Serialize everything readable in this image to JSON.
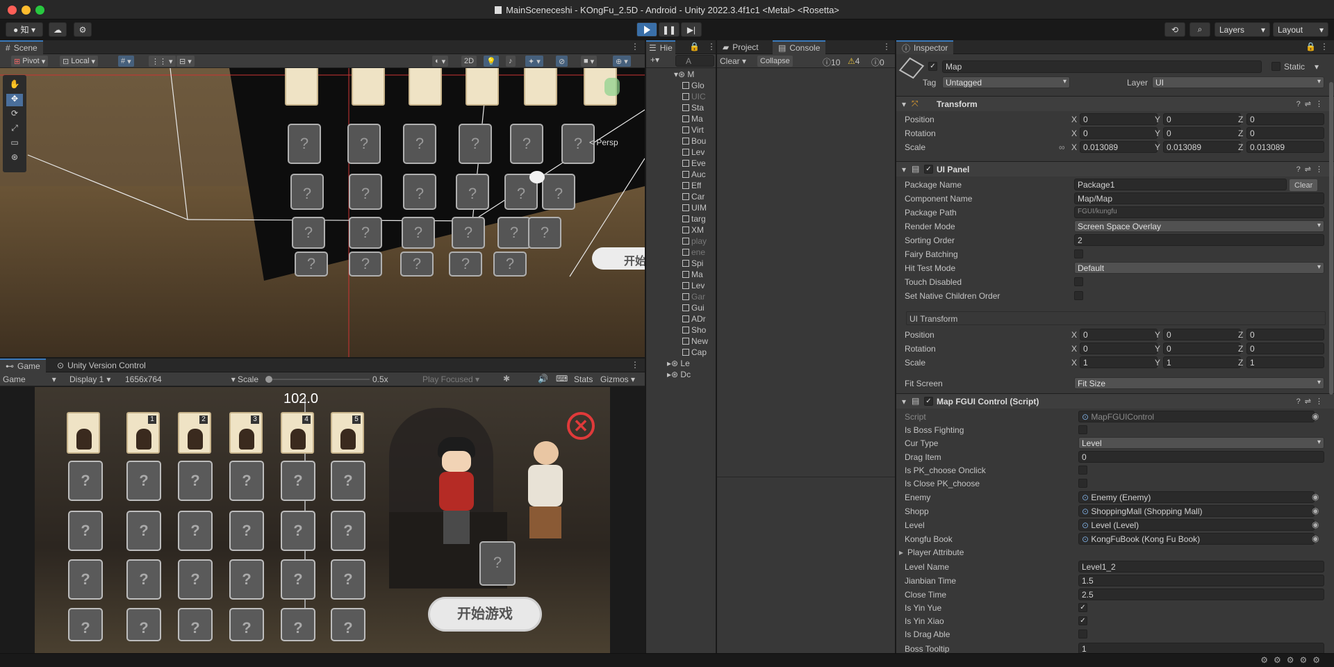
{
  "window": {
    "title": "MainSceneceshi - KOngFu_2.5D - Android - Unity 2022.3.4f1c1 <Metal> <Rosetta>"
  },
  "toolbar": {
    "account_label": "知",
    "layers_label": "Layers",
    "layout_label": "Layout"
  },
  "scene": {
    "tab_label": "Scene",
    "pivot_label": "Pivot",
    "local_label": "Local",
    "mode_2d_label": "2D",
    "persp_label": "< Persp",
    "start_label": "开始"
  },
  "game": {
    "tab_label": "Game",
    "vc_tab_label": "Unity Version Control",
    "game_dd": "Game",
    "display_dd": "Display 1",
    "resolution_dd": "1656x764",
    "scale_label": "Scale",
    "scale_value": "0.5x",
    "play_focused": "Play Focused",
    "stats_label": "Stats",
    "gizmos_label": "Gizmos",
    "counter": "102.0",
    "start_button": "开始游戏",
    "card_numbers": [
      "1",
      "2",
      "3",
      "4",
      "5"
    ]
  },
  "hierarchy": {
    "tab_label": "Hie",
    "search_placeholder": "A",
    "root_label": "M",
    "items": [
      "Glo",
      "UIC",
      "Sta",
      "Ma",
      "Virt",
      "Bou",
      "Lev",
      "Eve",
      "Auc",
      "Eff",
      "Car",
      "UIM",
      "targ",
      "XM",
      "play",
      "ene",
      "Spi",
      "Ma",
      "Lev",
      "Gar",
      "Gui",
      "ADr",
      "Sho",
      "New",
      "Cap"
    ],
    "bottom_items": [
      "Le",
      "Dc"
    ]
  },
  "project": {
    "tab_label": "Project",
    "console_tab_label": "Console",
    "clear_label": "Clear",
    "collapse_label": "Collapse",
    "log_count": "10",
    "warn_count": "4",
    "error_count": "0"
  },
  "inspector": {
    "tab_label": "Inspector",
    "object_name": "Map",
    "static_label": "Static",
    "tag_label": "Tag",
    "tag_value": "Untagged",
    "layer_label": "Layer",
    "layer_value": "UI",
    "transform": {
      "title": "Transform",
      "position_label": "Position",
      "rotation_label": "Rotation",
      "scale_label": "Scale",
      "position": [
        "0",
        "0",
        "0"
      ],
      "rotation": [
        "0",
        "0",
        "0"
      ],
      "scale": [
        "0.013089",
        "0.013089",
        "0.013089"
      ]
    },
    "ui_panel": {
      "title": "UI Panel",
      "clear_label": "Clear",
      "fields": [
        {
          "label": "Package Name",
          "value": "Package1"
        },
        {
          "label": "Component Name",
          "value": "Map/Map"
        },
        {
          "label": "Package Path",
          "value": "FGUI/kungfu"
        },
        {
          "label": "Render Mode",
          "value": "Screen Space Overlay"
        },
        {
          "label": "Sorting Order",
          "value": "2"
        },
        {
          "label": "Fairy Batching",
          "value": ""
        },
        {
          "label": "Hit Test Mode",
          "value": "Default"
        },
        {
          "label": "Touch Disabled",
          "value": ""
        },
        {
          "label": "Set Native Children Order",
          "value": ""
        }
      ],
      "ui_transform_label": "UI Transform",
      "position": [
        "0",
        "0",
        "0"
      ],
      "rotation": [
        "0",
        "0",
        "0"
      ],
      "scale": [
        "1",
        "1",
        "1"
      ],
      "fit_screen_label": "Fit Screen",
      "fit_screen_value": "Fit Size"
    },
    "x_label": "X",
    "y_label": "Y",
    "z_label": "Z",
    "script_comp": {
      "title": "Map FGUI Control (Script)",
      "fields": [
        {
          "label": "Script",
          "value": "MapFGUIControl"
        },
        {
          "label": "Is Boss Fighting",
          "value": ""
        },
        {
          "label": "Cur Type",
          "value": "Level"
        },
        {
          "label": "Drag Item",
          "value": "0"
        },
        {
          "label": "Is PK_choose Onclick",
          "value": ""
        },
        {
          "label": "Is Close PK_choose",
          "value": ""
        },
        {
          "label": "Enemy",
          "value": "Enemy (Enemy)"
        },
        {
          "label": "Shopp",
          "value": "ShoppingMall (Shopping Mall)"
        },
        {
          "label": "Level",
          "value": "Level (Level)"
        },
        {
          "label": "Kongfu Book",
          "value": "KongFuBook (Kong Fu Book)"
        },
        {
          "label": "Player Attribute",
          "value": ""
        },
        {
          "label": "Level Name",
          "value": "Level1_2"
        },
        {
          "label": "Jianbian Time",
          "value": "1.5"
        },
        {
          "label": "Close Time",
          "value": "2.5"
        },
        {
          "label": "Is Yin Yue",
          "value": "✓"
        },
        {
          "label": "Is Yin Xiao",
          "value": "✓"
        },
        {
          "label": "Is Drag Able",
          "value": ""
        },
        {
          "label": "Boss Tooltip",
          "value": "1"
        }
      ]
    }
  }
}
